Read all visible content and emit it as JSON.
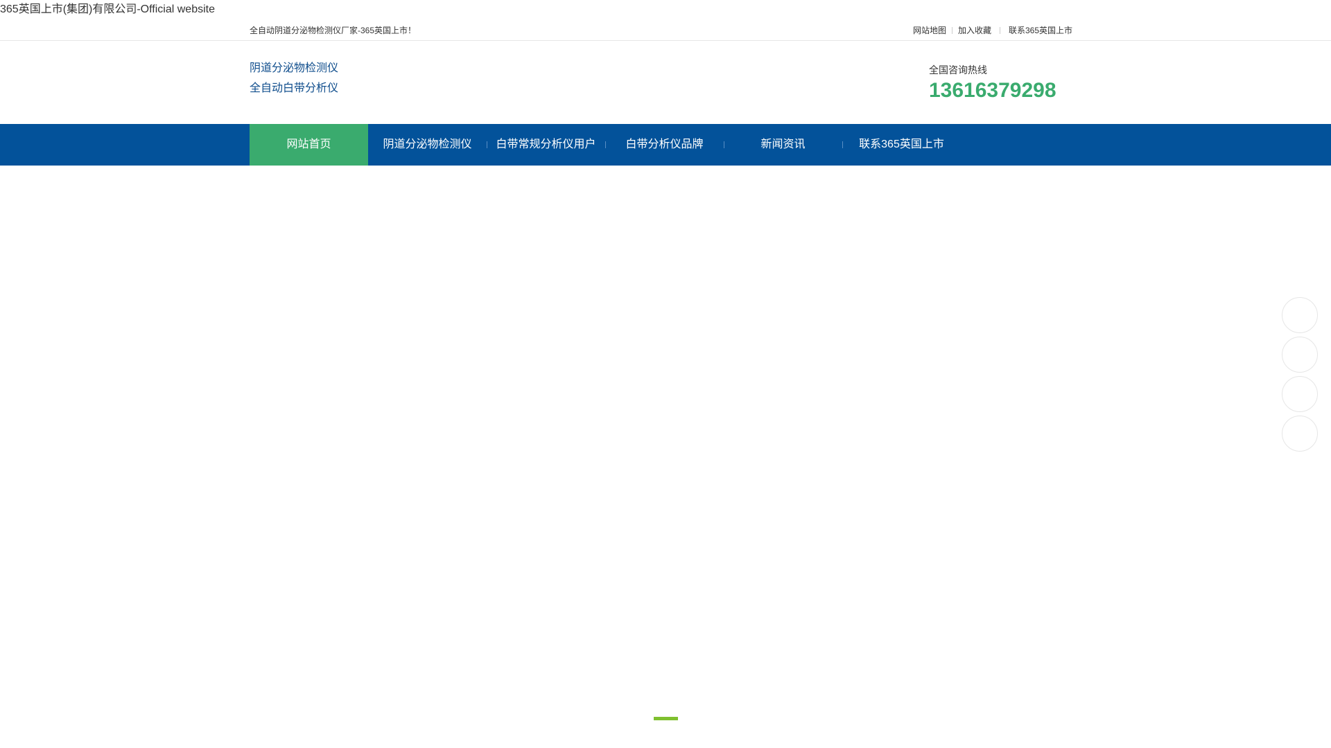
{
  "site": {
    "title": "365英国上市(集团)有限公司-Official website"
  },
  "topbar": {
    "welcome": "全自动阴道分泌物检测仪厂家-365英国上市！",
    "links": [
      "网站地图",
      "加入收藏",
      "联系365英国上市"
    ]
  },
  "header": {
    "brand_line1": "阴道分泌物检测仪",
    "brand_line2": "全自动白带分析仪",
    "hotline_label": "全国咨询热线",
    "hotline_number": "13616379298"
  },
  "nav": {
    "items": [
      {
        "label": "网站首页",
        "active": true
      },
      {
        "label": "阴道分泌物检测仪",
        "active": false
      },
      {
        "label": "白带常规分析仪用户",
        "active": false
      },
      {
        "label": "白带分析仪品牌",
        "active": false
      },
      {
        "label": "新闻资讯",
        "active": false
      },
      {
        "label": "联系365英国上市",
        "active": false
      }
    ]
  },
  "colors": {
    "nav_background": "#03529a",
    "nav_active": "#3aab6e",
    "brand_text": "#0f4d8c",
    "hotline": "#3aab6e",
    "slider_indicator": "#7fc02f"
  },
  "banner": {
    "slide_count": 1,
    "active_slide": 1
  },
  "floating_toolbar": {
    "button_count": 4
  }
}
